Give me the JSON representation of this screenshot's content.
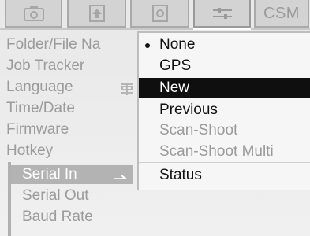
{
  "tabs": [
    {
      "icon": "camera-icon"
    },
    {
      "icon": "upload-icon"
    },
    {
      "icon": "image-icon"
    },
    {
      "icon": "settings-sliders-icon",
      "selected": true
    },
    {
      "label": "CSM"
    }
  ],
  "left_menu": {
    "items": [
      {
        "label": "Folder/File Na"
      },
      {
        "label": "Job Tracker"
      },
      {
        "label": "Language",
        "icon": "language-icon"
      },
      {
        "label": "Time/Date"
      },
      {
        "label": "Firmware"
      },
      {
        "label": "Hotkey"
      }
    ],
    "submenu": [
      {
        "label": "Serial In",
        "selected": true
      },
      {
        "label": "Serial Out"
      },
      {
        "label": "Baud Rate"
      }
    ]
  },
  "popup": {
    "options": [
      {
        "label": "None",
        "checked": true
      },
      {
        "label": "GPS"
      },
      {
        "label": "New",
        "highlighted": true
      },
      {
        "label": "Previous"
      },
      {
        "label": "Scan-Shoot",
        "disabled": true
      },
      {
        "label": "Scan-Shoot Multi",
        "disabled": true
      },
      {
        "label": "Status"
      }
    ]
  },
  "colors": {
    "tab_bg": "#d3d3d3",
    "text_muted": "#9b9b9b",
    "highlight_bg": "#0f0f0f",
    "selected_item_bg": "#b3b3b3"
  }
}
